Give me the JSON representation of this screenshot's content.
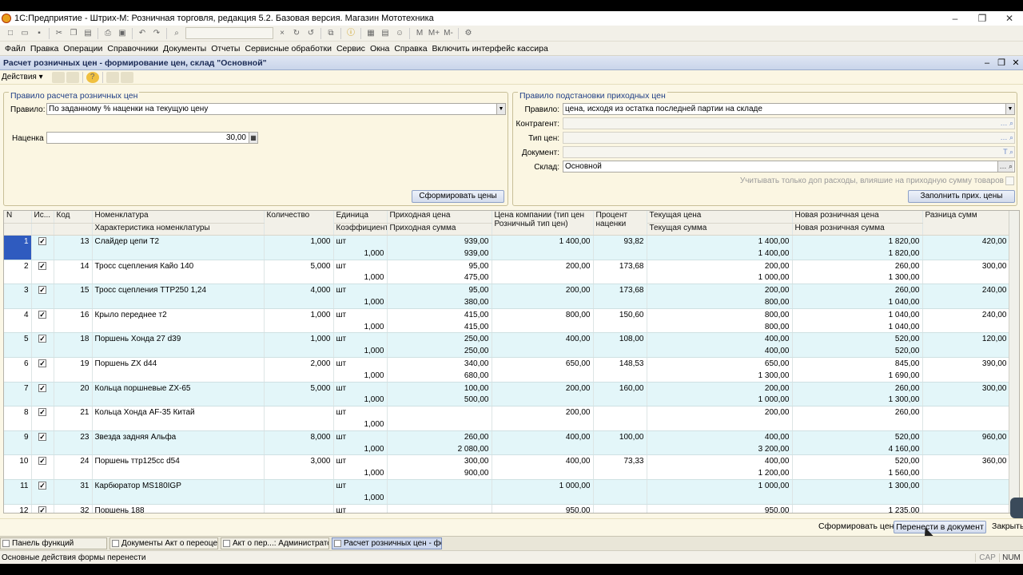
{
  "app": {
    "title": "1С:Предприятие - Штрих-М: Розничная торговля, редакция 5.2. Базовая версия. Магазин Мототехника"
  },
  "menu": [
    "Файл",
    "Правка",
    "Операции",
    "Справочники",
    "Документы",
    "Отчеты",
    "Сервисные обработки",
    "Сервис",
    "Окна",
    "Справка",
    "Включить интерфейс кассира"
  ],
  "form": {
    "title": "Расчет розничных цен - формирование цен, склад \"Основной\"",
    "actions_label": "Действия ▾"
  },
  "left_group": {
    "title": "Правило расчета розничных цен",
    "rule_label": "Правило:",
    "rule_value": "По заданному % наценки на текущую цену",
    "markup_label": "Наценка",
    "markup_value": "30,00",
    "form_button": "Сформировать цены"
  },
  "right_group": {
    "title": "Правило подстановки приходных цен",
    "rule_label": "Правило:",
    "rule_value": "цена, исходя из остатка последней партии на складе",
    "contractor_label": "Контрагент:",
    "contractor_value": "",
    "price_type_label": "Тип цен:",
    "price_type_value": "",
    "document_label": "Документ:",
    "document_value": "",
    "warehouse_label": "Склад:",
    "warehouse_value": "Основной",
    "checkbox_label": "Учитывать только доп расходы, влияшие на приходную сумму товаров",
    "fill_button": "Заполнить прих. цены"
  },
  "columns": {
    "n": "N",
    "is": "Ис...",
    "code": "Код",
    "item": "Номенклатура",
    "item2": "Характеристика номенклатуры",
    "qty": "Количество",
    "unit": "Единица",
    "coef": "Коэффициент",
    "in_price": "Приходная цена",
    "in_sum": "Приходная сумма",
    "company_price": "Цена компании (тип цен Розничный тип цен)",
    "pct": "Процент наценки",
    "cur_price": "Текущая цена",
    "cur_sum": "Текущая сумма",
    "new_price": "Новая розничная цена",
    "new_sum": "Новая розничная сумма",
    "diff": "Разница сумм"
  },
  "rows": [
    {
      "n": "1",
      "code": "13",
      "name": "Слайдер цепи Т2",
      "qty": "1,000",
      "unit": "шт",
      "coef": "1,000",
      "in_price": "939,00",
      "in_sum": "939,00",
      "company": "1 400,00",
      "pct": "93,82",
      "cur_price": "1 400,00",
      "cur_sum": "1 400,00",
      "new_price": "1 820,00",
      "new_sum": "1 820,00",
      "diff": "420,00"
    },
    {
      "n": "2",
      "code": "14",
      "name": "Тросс сцепления Кайо 140",
      "qty": "5,000",
      "unit": "шт",
      "coef": "1,000",
      "in_price": "95,00",
      "in_sum": "475,00",
      "company": "200,00",
      "pct": "173,68",
      "cur_price": "200,00",
      "cur_sum": "1 000,00",
      "new_price": "260,00",
      "new_sum": "1 300,00",
      "diff": "300,00"
    },
    {
      "n": "3",
      "code": "15",
      "name": "Тросс сцепления TTP250 1,24",
      "qty": "4,000",
      "unit": "шт",
      "coef": "1,000",
      "in_price": "95,00",
      "in_sum": "380,00",
      "company": "200,00",
      "pct": "173,68",
      "cur_price": "200,00",
      "cur_sum": "800,00",
      "new_price": "260,00",
      "new_sum": "1 040,00",
      "diff": "240,00"
    },
    {
      "n": "4",
      "code": "16",
      "name": "Крыло переднее т2",
      "qty": "1,000",
      "unit": "шт",
      "coef": "1,000",
      "in_price": "415,00",
      "in_sum": "415,00",
      "company": "800,00",
      "pct": "150,60",
      "cur_price": "800,00",
      "cur_sum": "800,00",
      "new_price": "1 040,00",
      "new_sum": "1 040,00",
      "diff": "240,00"
    },
    {
      "n": "5",
      "code": "18",
      "name": "Поршень Хонда 27 d39",
      "qty": "1,000",
      "unit": "шт",
      "coef": "1,000",
      "in_price": "250,00",
      "in_sum": "250,00",
      "company": "400,00",
      "pct": "108,00",
      "cur_price": "400,00",
      "cur_sum": "400,00",
      "new_price": "520,00",
      "new_sum": "520,00",
      "diff": "120,00"
    },
    {
      "n": "6",
      "code": "19",
      "name": "Поршень ZX d44",
      "qty": "2,000",
      "unit": "шт",
      "coef": "1,000",
      "in_price": "340,00",
      "in_sum": "680,00",
      "company": "650,00",
      "pct": "148,53",
      "cur_price": "650,00",
      "cur_sum": "1 300,00",
      "new_price": "845,00",
      "new_sum": "1 690,00",
      "diff": "390,00"
    },
    {
      "n": "7",
      "code": "20",
      "name": "Кольца поршневые ZX-65",
      "qty": "5,000",
      "unit": "шт",
      "coef": "1,000",
      "in_price": "100,00",
      "in_sum": "500,00",
      "company": "200,00",
      "pct": "160,00",
      "cur_price": "200,00",
      "cur_sum": "1 000,00",
      "new_price": "260,00",
      "new_sum": "1 300,00",
      "diff": "300,00"
    },
    {
      "n": "8",
      "code": "21",
      "name": "Кольца Хонда AF-35 Китай",
      "qty": "",
      "unit": "шт",
      "coef": "1,000",
      "in_price": "",
      "in_sum": "",
      "company": "200,00",
      "pct": "",
      "cur_price": "200,00",
      "cur_sum": "",
      "new_price": "260,00",
      "new_sum": "",
      "diff": ""
    },
    {
      "n": "9",
      "code": "23",
      "name": "Звезда задняя Альфа",
      "qty": "8,000",
      "unit": "шт",
      "coef": "1,000",
      "in_price": "260,00",
      "in_sum": "2 080,00",
      "company": "400,00",
      "pct": "100,00",
      "cur_price": "400,00",
      "cur_sum": "3 200,00",
      "new_price": "520,00",
      "new_sum": "4 160,00",
      "diff": "960,00"
    },
    {
      "n": "10",
      "code": "24",
      "name": "Поршень ттр125cc d54",
      "qty": "3,000",
      "unit": "шт",
      "coef": "1,000",
      "in_price": "300,00",
      "in_sum": "900,00",
      "company": "400,00",
      "pct": "73,33",
      "cur_price": "400,00",
      "cur_sum": "1 200,00",
      "new_price": "520,00",
      "new_sum": "1 560,00",
      "diff": "360,00"
    },
    {
      "n": "11",
      "code": "31",
      "name": "Карбюратор MS180IGP",
      "qty": "",
      "unit": "шт",
      "coef": "1,000",
      "in_price": "",
      "in_sum": "",
      "company": "1 000,00",
      "pct": "",
      "cur_price": "1 000,00",
      "cur_sum": "",
      "new_price": "1 300,00",
      "new_sum": "",
      "diff": ""
    },
    {
      "n": "12",
      "code": "32",
      "name": "Поршень 188",
      "qty": "",
      "unit": "шт",
      "coef": "",
      "in_price": "",
      "in_sum": "",
      "company": "950,00",
      "pct": "",
      "cur_price": "950,00",
      "cur_sum": "",
      "new_price": "1 235,00",
      "new_sum": "",
      "diff": ""
    }
  ],
  "footer": {
    "form_prices": "Сформировать цены",
    "transfer": "Перенести в документ",
    "close": "Закрыть"
  },
  "taskbar": [
    "Панель функций",
    "Документы Акт о переоцен...",
    "Акт о пер...: Администратор *",
    "Расчет розничных цен - фо..."
  ],
  "status": {
    "text": "Основные действия формы перенести",
    "caps": "CAP",
    "num": "NUM"
  }
}
